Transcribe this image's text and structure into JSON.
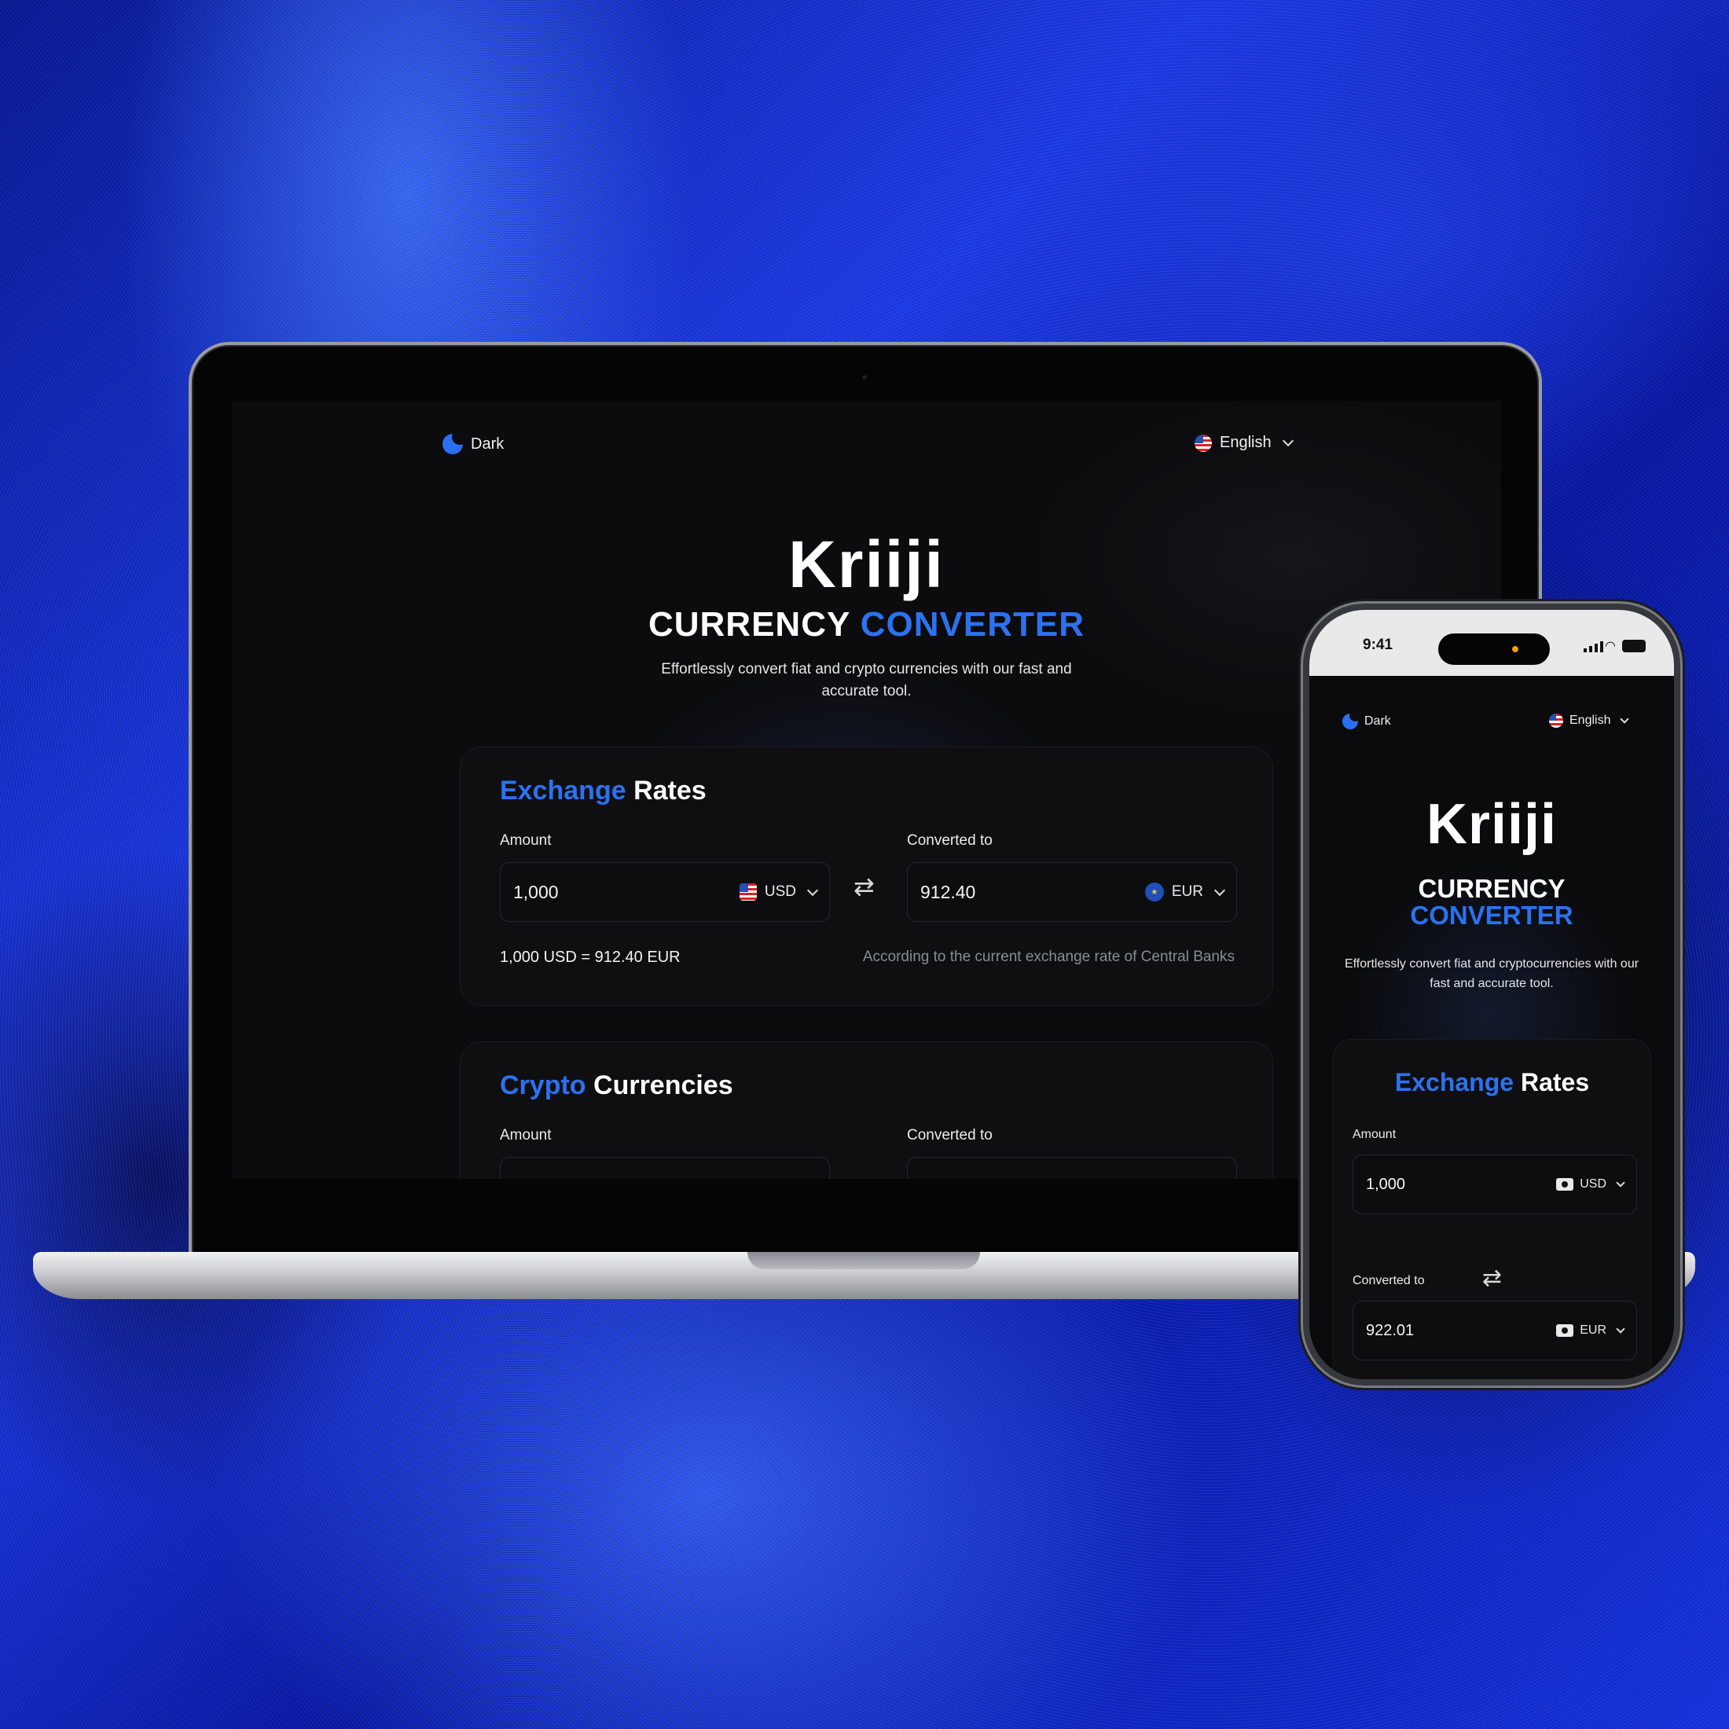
{
  "theme_label": "Dark",
  "language_label": "English",
  "brand": "Kriiji",
  "headline": {
    "part1": "CURRENCY",
    "part2": "CONVERTER"
  },
  "subtitle": "Effortlessly convert fiat and crypto currencies with our fast and accurate tool.",
  "exchange_card": {
    "title_highlight": "Exchange",
    "title_rest": "Rates",
    "amount_label": "Amount",
    "converted_label": "Converted to",
    "amount_value": "1,000",
    "amount_currency": "USD",
    "converted_value": "912.40",
    "converted_currency": "EUR",
    "rate_text": "1,000 USD = 912.40 EUR",
    "rate_note": "According to the current exchange rate of Central Banks"
  },
  "crypto_card": {
    "title_highlight": "Crypto",
    "title_rest": "Currencies",
    "amount_label": "Amount",
    "converted_label": "Converted to"
  },
  "phone": {
    "time": "9:41",
    "theme_label": "Dark",
    "language_label": "English",
    "brand": "Kriiji",
    "headline_line1": "CURRENCY",
    "headline_line2": "CONVERTER",
    "subtitle": "Effortlessly convert fiat and cryptocurrencies with our fast and accurate tool.",
    "card": {
      "title_highlight": "Exchange",
      "title_rest": "Rates",
      "amount_label": "Amount",
      "amount_value": "1,000",
      "amount_currency": "USD",
      "converted_label": "Converted to",
      "converted_value": "922.01",
      "converted_currency": "EUR"
    }
  },
  "colors": {
    "accent": "#2c72f0",
    "background": "#0c0c0e",
    "card": "#0f0f12"
  },
  "icons": [
    "moon-icon",
    "us-flag-icon",
    "eu-flag-icon",
    "chevron-down-icon",
    "swap-arrows-icon",
    "cash-icon",
    "signal-icon",
    "wifi-icon",
    "battery-icon"
  ]
}
